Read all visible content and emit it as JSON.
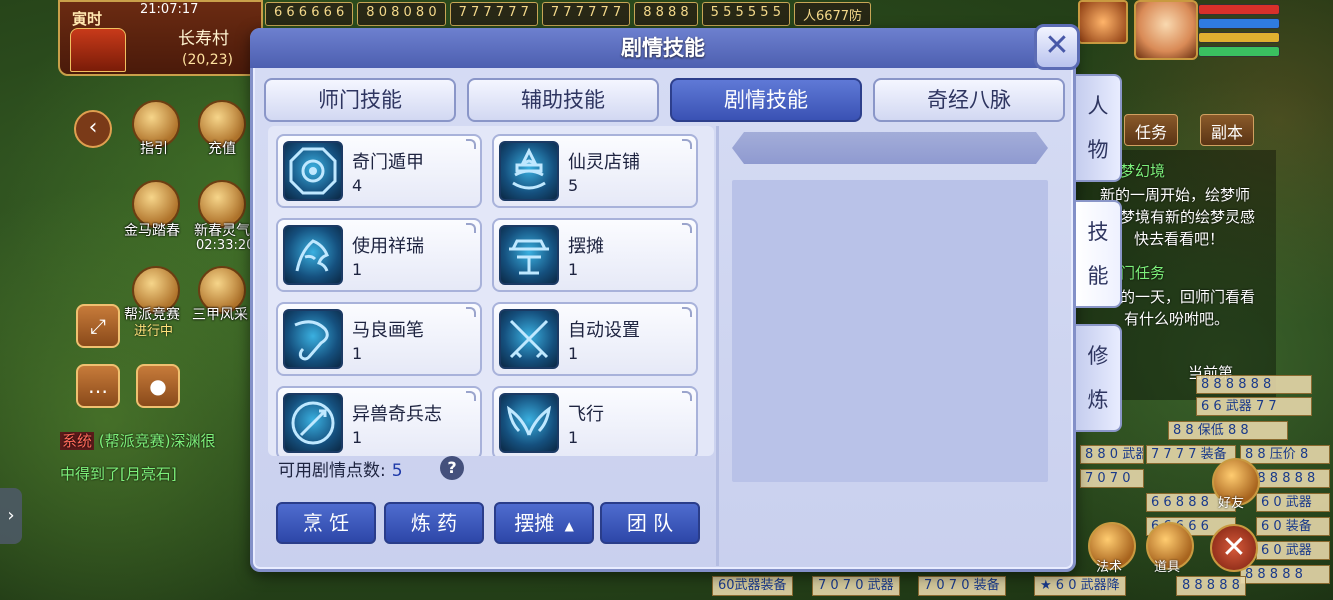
{
  "hud": {
    "time_tag": "寅时",
    "clock": "21:07:17",
    "location": "长寿村",
    "coords": "(20,23)",
    "top_stalls": [
      "6 6 6 6 6 6",
      "8 0 8 0 8 0",
      "7 7 7 7 7 7",
      "7 7 7 7 7 7",
      "8 8 8 8",
      "5 5 5 5 5 5",
      "人6677防"
    ],
    "left_buttons": [
      {
        "label": "指引",
        "icon": "guide-scroll-icon"
      },
      {
        "label": "充值",
        "icon": "recharge-chest-icon"
      },
      {
        "label": "金马踏春",
        "icon": "golden-horse-icon"
      },
      {
        "label": "新春灵气",
        "icon": "spring-tree-icon"
      },
      {
        "label": "帮派竞赛",
        "icon": "guild-race-icon"
      },
      {
        "label": "三甲风采",
        "icon": "ranking-icon"
      }
    ],
    "event_time": "02:33:20",
    "event_status": "进行中",
    "chat": [
      {
        "channel": "系统",
        "text": "(帮派竞赛)深渊很"
      },
      {
        "channel": "",
        "text": "中得到了[月亮石]"
      }
    ],
    "right_tabs": {
      "task": "任务",
      "dungeon": "副本"
    },
    "quest_lines": [
      "梦幻境",
      "新的一周开始，绘梦师",
      "梦境有新的绘梦灵感",
      "快去看看吧！",
      "门任务",
      "的一天，回师门看看",
      "有什么吩咐吧。",
      "当前第"
    ],
    "right_icons": [
      {
        "label": "好友",
        "icon": "friends-icon"
      },
      {
        "label": "法术",
        "icon": "spell-bell-icon"
      },
      {
        "label": "道具",
        "icon": "item-chest-icon"
      }
    ],
    "stalls": [
      "8 8 8 8 8 8",
      "6 6 武器 7 7",
      "8 8 保低 8 8",
      "8 8 0 武器",
      "7 7 7 7 装备",
      "8 8 压价 8",
      "7 0 7 0",
      "8 8 8 8 8 8",
      "6 6 8 8 8",
      "6 0 武器",
      "6 0 装备",
      "6 6 6 6 6",
      "6 0 武器",
      "8 8 8 8 8"
    ],
    "bottom_stalls": [
      "60武器装备",
      "7 0 7 0 武器",
      "7 0 7 0 装备",
      "★ 6 0 武器降",
      "8 8 8 8 8"
    ]
  },
  "dialog": {
    "title": "剧情技能",
    "tabs": [
      {
        "label": "师门技能",
        "active": false
      },
      {
        "label": "辅助技能",
        "active": false
      },
      {
        "label": "剧情技能",
        "active": true
      },
      {
        "label": "奇经八脉",
        "active": false
      }
    ],
    "skills": [
      {
        "name": "奇门遁甲",
        "level": "4",
        "icon": "octagon-seal-icon"
      },
      {
        "name": "仙灵店铺",
        "level": "5",
        "icon": "lotus-shop-icon"
      },
      {
        "name": "使用祥瑞",
        "level": "1",
        "icon": "auspicious-beast-icon"
      },
      {
        "name": "摆摊",
        "level": "1",
        "icon": "stall-table-icon"
      },
      {
        "name": "马良画笔",
        "level": "1",
        "icon": "magic-brush-icon"
      },
      {
        "name": "自动设置",
        "level": "1",
        "icon": "crossed-swords-icon"
      },
      {
        "name": "异兽奇兵志",
        "level": "1",
        "icon": "sword-medal-icon"
      },
      {
        "name": "飞行",
        "level": "1",
        "icon": "wings-icon"
      }
    ],
    "points_label": "可用剧情点数:",
    "points_value": "5",
    "help": "?",
    "buttons": {
      "cook": "烹 饪",
      "alchemy": "炼 药",
      "stall": "摆摊",
      "team": "团 队"
    },
    "side_tabs": [
      {
        "label": "人物",
        "active": false
      },
      {
        "label": "技能",
        "active": true
      },
      {
        "label": "修炼",
        "active": false
      }
    ],
    "close": "✕"
  }
}
